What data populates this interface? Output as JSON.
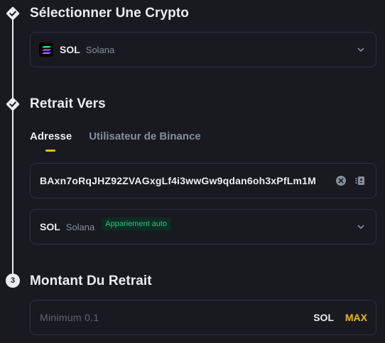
{
  "steps": [
    {
      "title": "Sélectionner Une Crypto"
    },
    {
      "title": "Retrait Vers"
    },
    {
      "title": "Montant Du Retrait",
      "number": "3"
    }
  ],
  "coin_select": {
    "symbol": "SOL",
    "name": "Solana",
    "icon": "solana-logo-icon"
  },
  "withdraw_to": {
    "tabs": [
      {
        "label": "Adresse",
        "active": true
      },
      {
        "label": "Utilisateur de Binance",
        "active": false
      }
    ],
    "address_value": "BAxn7oRqJHZ92ZVAGxgLf4i3wwGw9qdan6oh3xPfLm1M",
    "clear_icon": "close-circle-icon",
    "address_book_icon": "address-book-icon"
  },
  "network_select": {
    "symbol": "SOL",
    "name": "Solana",
    "badge": "Appariement auto"
  },
  "amount": {
    "placeholder": "Minimum 0.1",
    "unit": "SOL",
    "max_label": "MAX"
  },
  "colors": {
    "background": "#181a20",
    "accent": "#f0b90b",
    "border": "#2b3139",
    "muted": "#848e9c",
    "green": "#2ebd85"
  }
}
